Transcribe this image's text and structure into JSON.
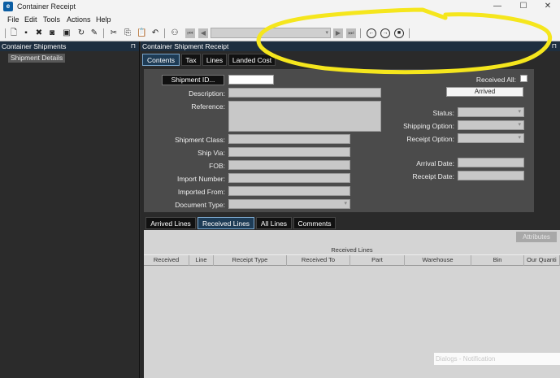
{
  "window": {
    "title": "Container Receipt",
    "minimize": "—",
    "maximize": "☐",
    "close": "✕"
  },
  "menu": {
    "file": "File",
    "edit": "Edit",
    "tools": "Tools",
    "actions": "Actions",
    "help": "Help"
  },
  "left_panel": {
    "title": "Container Shipments",
    "pin": "⊓",
    "tree_item": "Shipment Details"
  },
  "right_panel": {
    "title": "Container Shipment Receipt",
    "pin": "⊓"
  },
  "top_tabs": [
    "Contents",
    "Tax",
    "Lines",
    "Landed Cost"
  ],
  "form": {
    "shipment_id_button": "Shipment ID...",
    "shipment_id_value": "",
    "description_label": "Description:",
    "reference_label": "Reference:",
    "shipment_class_label": "Shipment Class:",
    "ship_via_label": "Ship Via:",
    "fob_label": "FOB:",
    "import_number_label": "Import Number:",
    "imported_from_label": "Imported From:",
    "document_type_label": "Document Type:",
    "received_all_label": "Received All:",
    "arrived_button": "Arrived",
    "status_label": "Status:",
    "shipping_option_label": "Shipping Option:",
    "receipt_option_label": "Receipt Option:",
    "arrival_date_label": "Arrival Date:",
    "receipt_date_label": "Receipt Date:"
  },
  "lower_tabs": [
    "Arrived Lines",
    "Received Lines",
    "All Lines",
    "Comments"
  ],
  "grid": {
    "attributes_button": "Attributes",
    "title": "Received Lines",
    "columns": [
      "Received",
      "Line",
      "Receipt Type",
      "Received To",
      "Part",
      "Warehouse",
      "Bin",
      "Our Quanti"
    ]
  },
  "notification": "Dialogs - Notification",
  "colors": {
    "annotation": "#f5e61d",
    "tab_active": "#1e3c56",
    "panel_header": "#1e2f40"
  }
}
